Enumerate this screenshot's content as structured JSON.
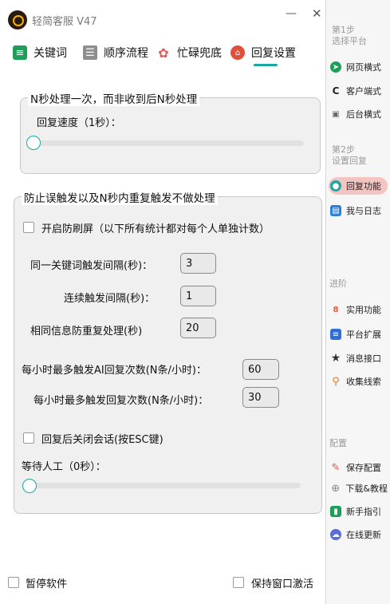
{
  "app": {
    "title": "轻简客服  V47"
  },
  "window": {
    "minimize": "—",
    "close": "✕"
  },
  "tabs": [
    {
      "label": "关键词"
    },
    {
      "label": "顺序流程"
    },
    {
      "label": "忙碌兜底"
    },
    {
      "label": "回复设置"
    }
  ],
  "section1": {
    "title": "N秒处理一次，而非收到后N秒处理",
    "speed_label": "回复速度（1秒）：",
    "speed_value": 0
  },
  "section2": {
    "title": "防止误触发以及N秒内重复触发不做处理",
    "antispam_label": "开启防刷屏（以下所有统计都对每个人单独计数）",
    "keyword_interval_label": "同一关键词触发间隔(秒)：",
    "keyword_interval_value": "3",
    "continuous_interval_label": "连续触发间隔(秒)：",
    "continuous_interval_value": "1",
    "duplicate_label": "相同信息防重复处理(秒)",
    "duplicate_value": "20",
    "ai_max_label": "每小时最多触发AI回复次数(N条/小时)：",
    "ai_max_value": "60",
    "reply_max_label": "每小时最多触发回复次数(N条/小时)：",
    "reply_max_value": "30",
    "close_session_label": "回复后关闭会话(按ESC键)",
    "wait_label": "等待人工（0秒）：",
    "wait_value": 0
  },
  "bottom": {
    "pause_label": "暂停软件",
    "keep_active_label": "保持窗口激活"
  },
  "sidebar": {
    "step1": "第1步\n选择平台",
    "web_mode": "网页横式",
    "client_mode": "客户端式",
    "backend_mode": "后台横式",
    "step2": "第2步\n设置回复",
    "reply_function": "回复功能",
    "my_log": "我与日志",
    "advanced": "进阶",
    "utility": "实用功能",
    "platform_ext": "平台扩展",
    "message_api": "消息接口",
    "collect_leads": "收集线索",
    "config": "配置",
    "save_config": "保存配置",
    "download_tutorial": "下载&教程",
    "beginner_guide": "新手指引",
    "online_update": "在线更新"
  },
  "colors": {
    "accent": "#1aa7a1",
    "active_bg": "#f3c5c2"
  }
}
